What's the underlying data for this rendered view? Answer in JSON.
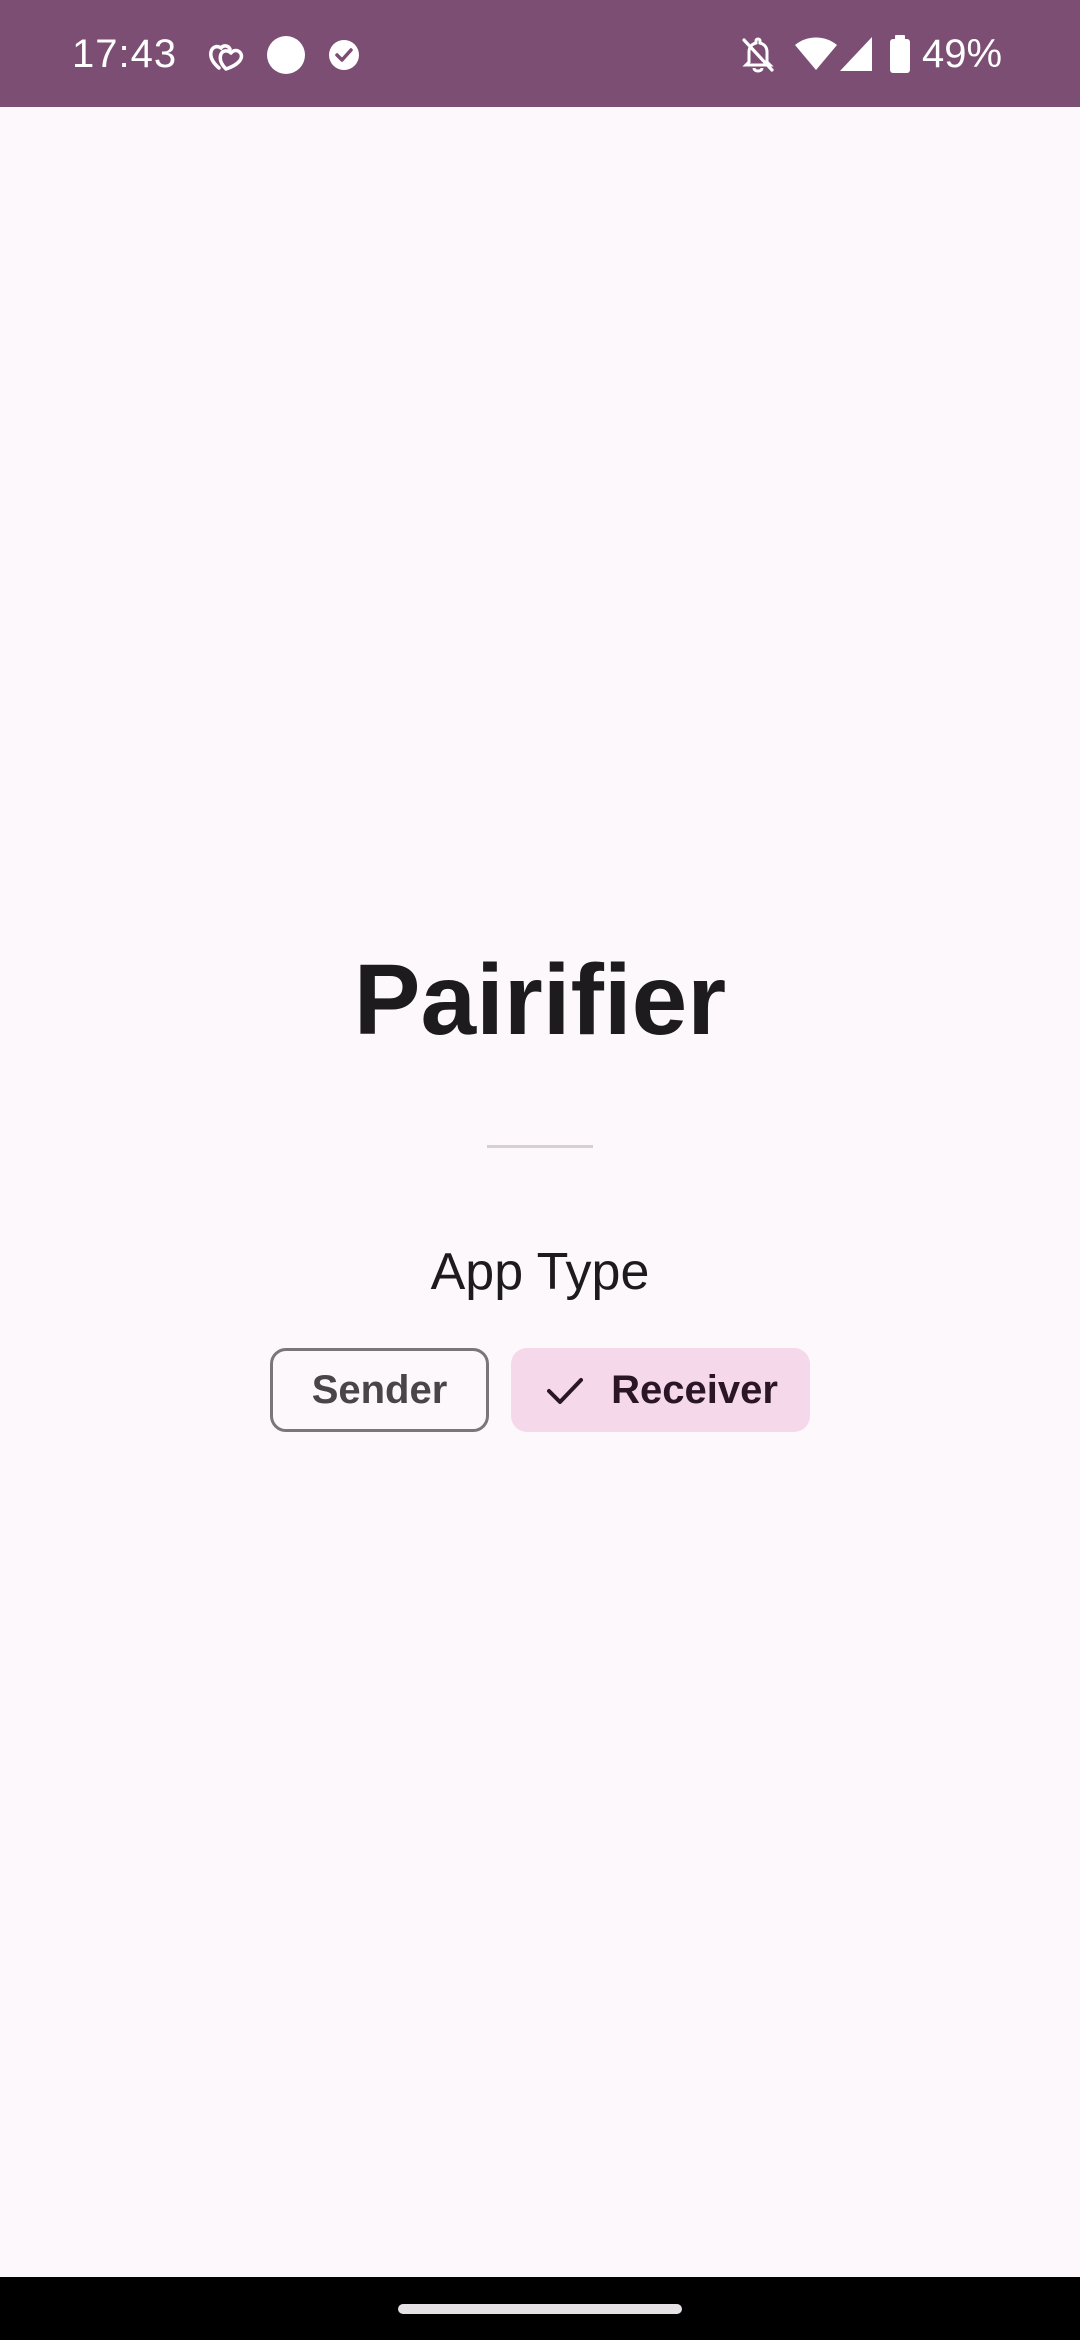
{
  "status_bar": {
    "time": "17:43",
    "battery_percent": "49%",
    "icons": [
      "hearts-icon",
      "circle-icon",
      "check-circle-icon",
      "notifications-off-icon",
      "wifi-icon",
      "cell-signal-icon",
      "battery-icon"
    ],
    "background_color": "#7D4E74"
  },
  "app": {
    "title": "Pairifier",
    "section_label": "App Type",
    "chips": [
      {
        "label": "Sender",
        "selected": false
      },
      {
        "label": "Receiver",
        "selected": true,
        "icon": "check-icon"
      }
    ],
    "selected_chip_color": "#F5D9EB"
  },
  "nav_bar": {
    "handle": "gesture-handle"
  }
}
